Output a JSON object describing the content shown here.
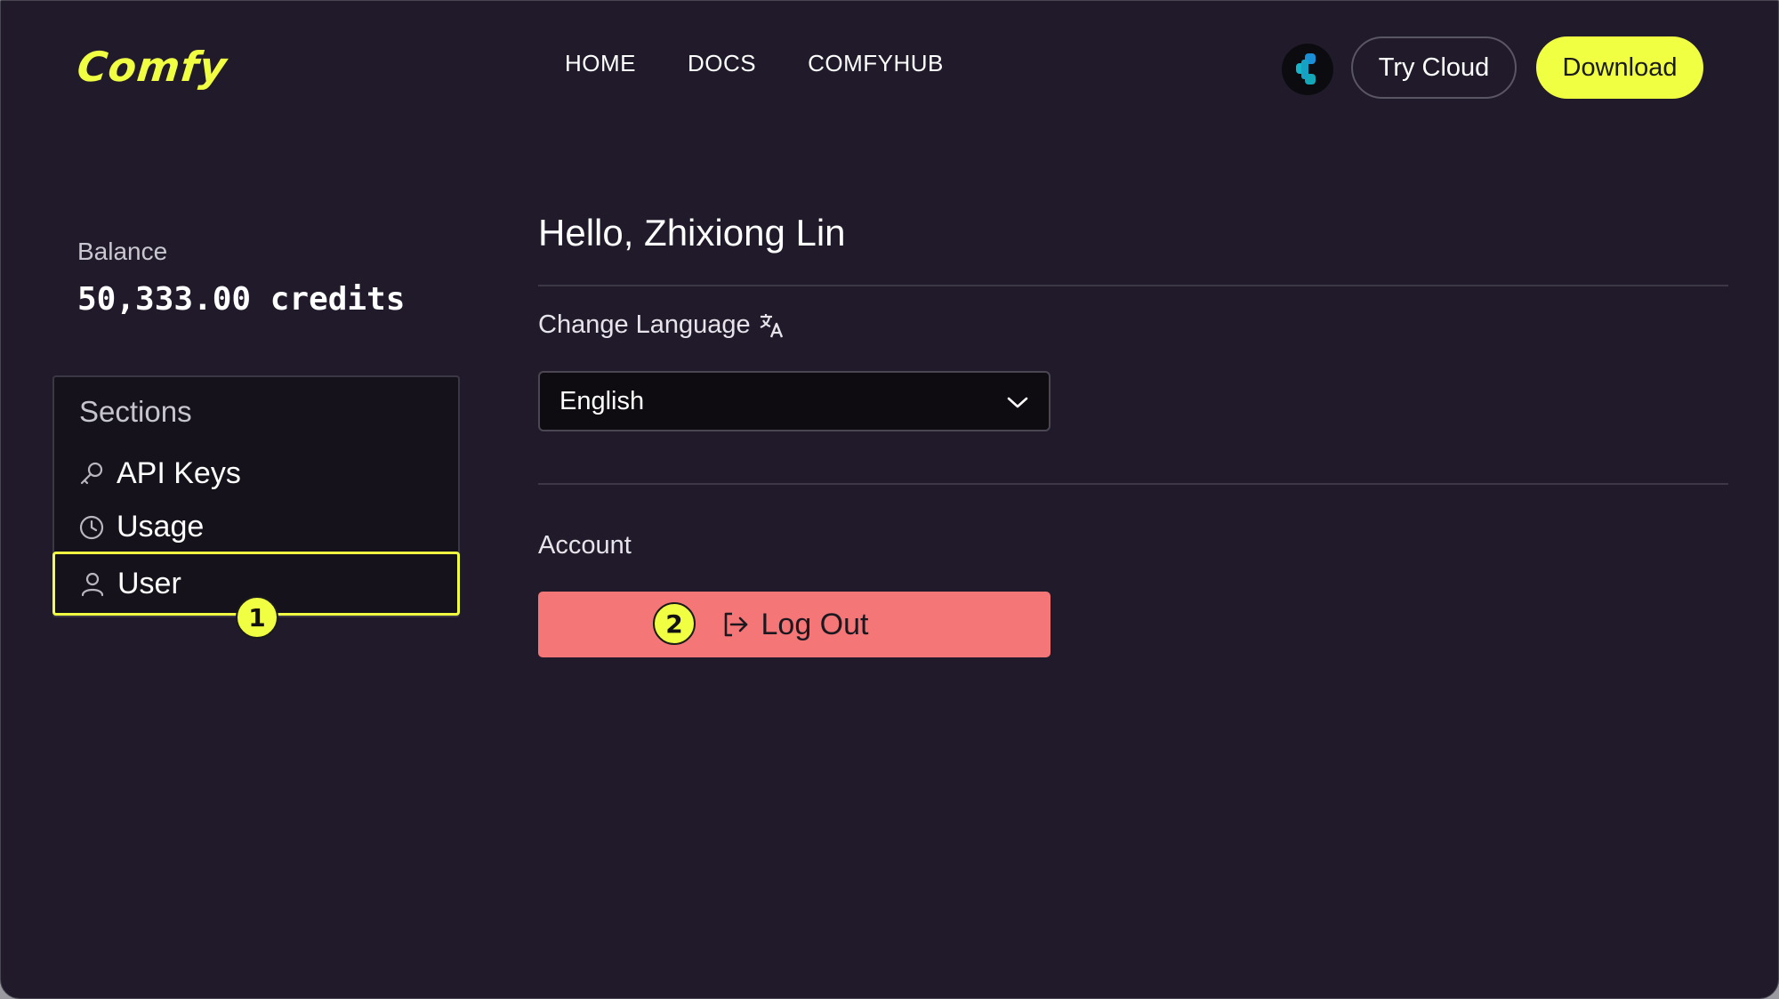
{
  "header": {
    "logo_text": "Comfy",
    "nav": [
      {
        "label": "HOME"
      },
      {
        "label": "DOCS"
      },
      {
        "label": "COMFYHUB"
      }
    ],
    "try_cloud_label": "Try Cloud",
    "download_label": "Download"
  },
  "balance": {
    "label": "Balance",
    "value": "50,333.00 credits"
  },
  "sections": {
    "title": "Sections",
    "items": [
      {
        "label": "API Keys",
        "icon": "key-icon"
      },
      {
        "label": "Usage",
        "icon": "clock-icon"
      },
      {
        "label": "User",
        "icon": "user-icon",
        "active": true
      }
    ]
  },
  "main": {
    "greeting": "Hello, Zhixiong Lin",
    "language": {
      "label": "Change Language",
      "selected": "English"
    },
    "account": {
      "label": "Account",
      "logout_label": "Log Out"
    }
  },
  "markers": [
    "1",
    "2"
  ],
  "colors": {
    "background": "#211a2b",
    "accent": "#f0ff41",
    "danger": "#f47676",
    "panel": "#15121b"
  }
}
